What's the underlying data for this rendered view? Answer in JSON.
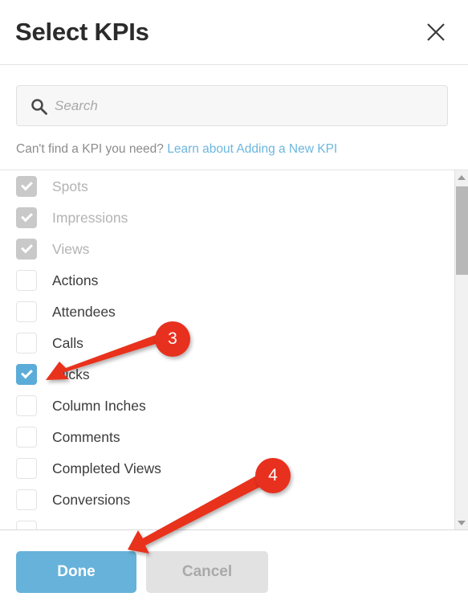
{
  "dialog": {
    "title": "Select KPIs",
    "close_icon": "close-icon"
  },
  "search": {
    "icon": "search-icon",
    "placeholder": "Search",
    "value": ""
  },
  "helper": {
    "text": "Can't find a KPI you need?",
    "link_text": "Learn about Adding a New KPI",
    "link_color": "#6cb7de"
  },
  "list": {
    "items": [
      {
        "label": "Spots",
        "checked": true,
        "disabled": true
      },
      {
        "label": "Impressions",
        "checked": true,
        "disabled": true
      },
      {
        "label": "Views",
        "checked": true,
        "disabled": true
      },
      {
        "label": "Actions",
        "checked": false,
        "disabled": false
      },
      {
        "label": "Attendees",
        "checked": false,
        "disabled": false
      },
      {
        "label": "Calls",
        "checked": false,
        "disabled": false
      },
      {
        "label": "Clicks",
        "checked": true,
        "disabled": false
      },
      {
        "label": "Column Inches",
        "checked": false,
        "disabled": false
      },
      {
        "label": "Comments",
        "checked": false,
        "disabled": false
      },
      {
        "label": "Completed Views",
        "checked": false,
        "disabled": false
      },
      {
        "label": "Conversions",
        "checked": false,
        "disabled": false
      },
      {
        "label": "",
        "checked": false,
        "disabled": false
      }
    ],
    "selected_color": "#5bacd8",
    "disabled_color": "#c9c9c9"
  },
  "scrollbar": {
    "up_icon": "chevron-up-icon",
    "down_icon": "chevron-down-icon"
  },
  "footer": {
    "done_label": "Done",
    "cancel_label": "Cancel",
    "done_color": "#67b2da"
  },
  "annotations": {
    "color": "#e8301f",
    "steps": [
      {
        "number": "3",
        "target": "clicks-checkbox"
      },
      {
        "number": "4",
        "target": "done-button"
      }
    ]
  }
}
